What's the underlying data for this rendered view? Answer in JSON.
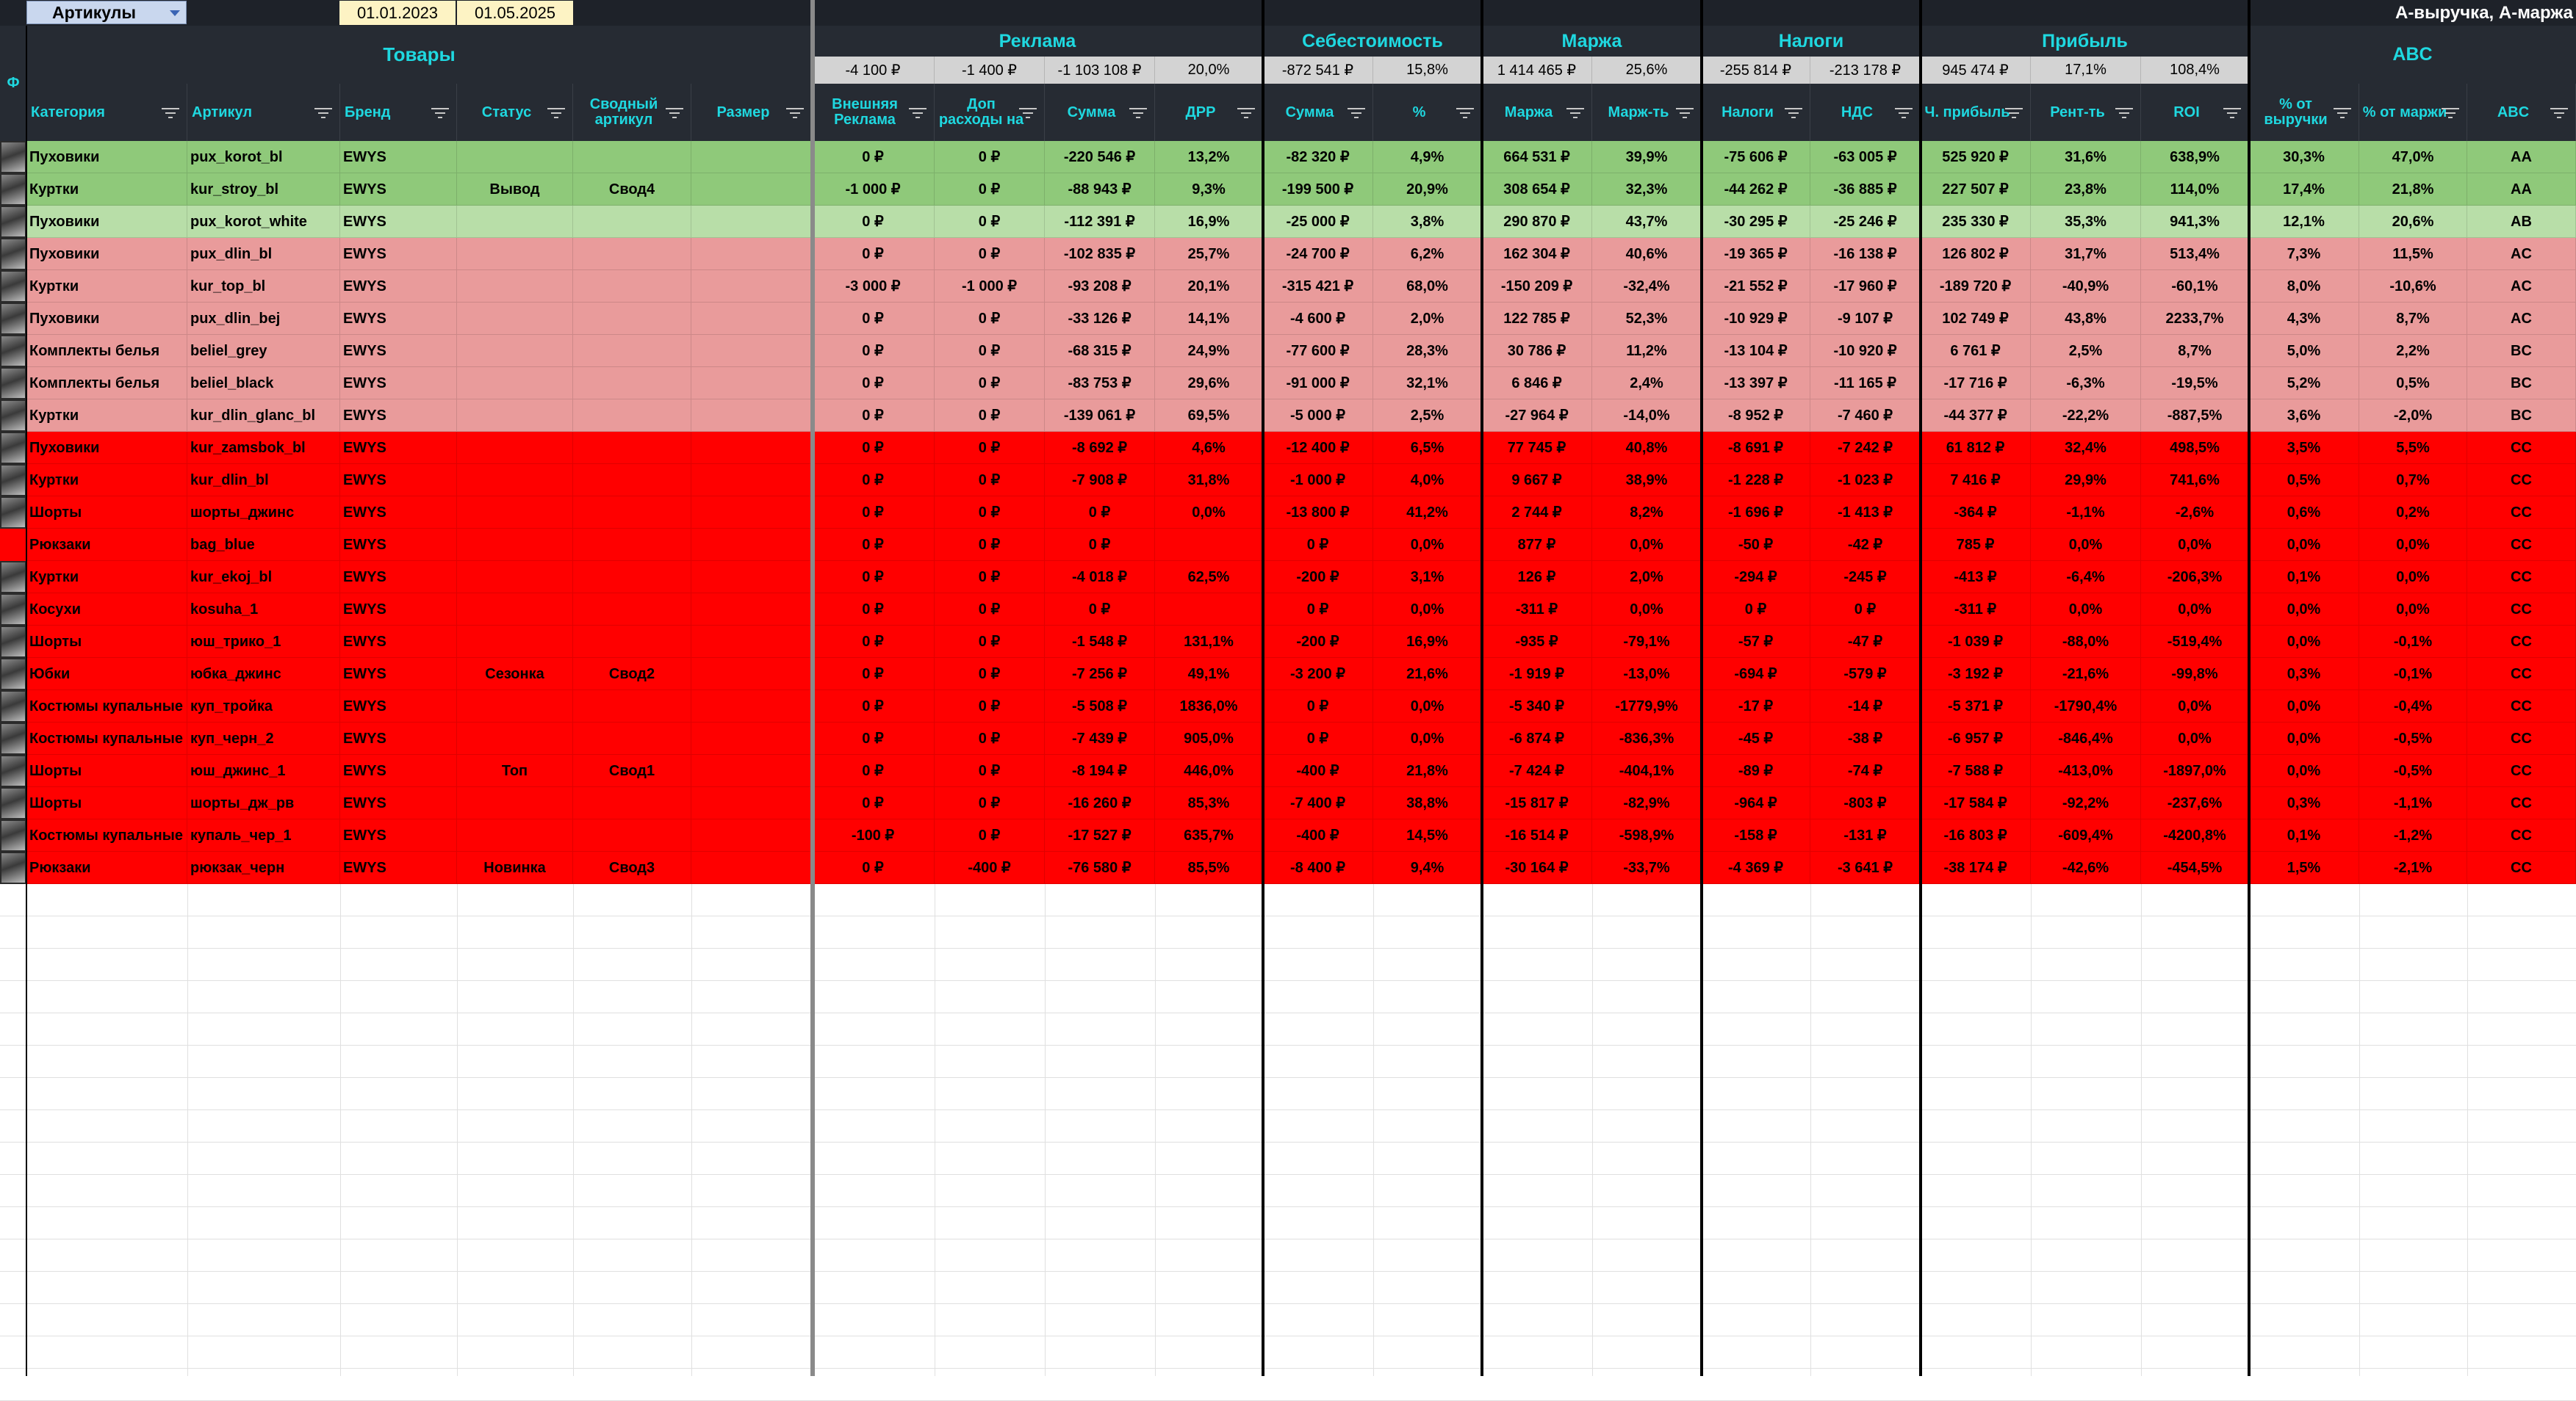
{
  "toolbar": {
    "selector_value": "Артикулы",
    "date_from": "01.01.2023",
    "date_to": "01.05.2025",
    "abc_mode": "А-выручка, А-маржа"
  },
  "colors": {
    "header_bg": "#262b33",
    "header_text": "#1fd8e0",
    "green_dark": "#8fc97a",
    "green_light": "#b8dea8",
    "pink": "#e99b9b",
    "red": "#ff0000"
  },
  "side_label": "Ф",
  "groups": {
    "goods": "Товары",
    "ads": "Реклама",
    "cost": "Себестоимость",
    "margin": "Маржа",
    "taxes": "Налоги",
    "profit": "Прибыль",
    "abc": "ABC"
  },
  "summary": [
    "-4 100 ₽",
    "-1 400 ₽",
    "-1 103 108 ₽",
    "20,0%",
    "-872 541 ₽",
    "15,8%",
    "1 414 465 ₽",
    "25,6%",
    "-255 814 ₽",
    "-213 178 ₽",
    "945 474 ₽",
    "17,1%",
    "108,4%"
  ],
  "columns": [
    "Категория",
    "Артикул",
    "Бренд",
    "Статус",
    "Сводный артикул",
    "Размер",
    "Внешняя Реклама",
    "Доп расходы на",
    "Сумма",
    "ДРР",
    "Сумма",
    "%",
    "Маржа",
    "Марж-ть",
    "Налоги",
    "НДС",
    "Ч. прибыль",
    "Рент-ть",
    "ROI",
    "% от выручки",
    "% от маржи",
    "ABC"
  ],
  "rows": [
    {
      "color": "green_dark",
      "photo": true,
      "cells": [
        "Пуховики",
        "pux_korot_bl",
        "EWYS",
        "",
        "",
        "",
        "0 ₽",
        "0 ₽",
        "-220 546 ₽",
        "13,2%",
        "-82 320 ₽",
        "4,9%",
        "664 531 ₽",
        "39,9%",
        "-75 606 ₽",
        "-63 005 ₽",
        "525 920 ₽",
        "31,6%",
        "638,9%",
        "30,3%",
        "47,0%",
        "AA"
      ]
    },
    {
      "color": "green_dark",
      "photo": true,
      "cells": [
        "Куртки",
        "kur_stroy_bl",
        "EWYS",
        "Вывод",
        "Свод4",
        "",
        "-1 000 ₽",
        "0 ₽",
        "-88 943 ₽",
        "9,3%",
        "-199 500 ₽",
        "20,9%",
        "308 654 ₽",
        "32,3%",
        "-44 262 ₽",
        "-36 885 ₽",
        "227 507 ₽",
        "23,8%",
        "114,0%",
        "17,4%",
        "21,8%",
        "AA"
      ]
    },
    {
      "color": "green_light",
      "photo": true,
      "cells": [
        "Пуховики",
        "pux_korot_white",
        "EWYS",
        "",
        "",
        "",
        "0 ₽",
        "0 ₽",
        "-112 391 ₽",
        "16,9%",
        "-25 000 ₽",
        "3,8%",
        "290 870 ₽",
        "43,7%",
        "-30 295 ₽",
        "-25 246 ₽",
        "235 330 ₽",
        "35,3%",
        "941,3%",
        "12,1%",
        "20,6%",
        "AB"
      ]
    },
    {
      "color": "pink",
      "photo": true,
      "cells": [
        "Пуховики",
        "pux_dlin_bl",
        "EWYS",
        "",
        "",
        "",
        "0 ₽",
        "0 ₽",
        "-102 835 ₽",
        "25,7%",
        "-24 700 ₽",
        "6,2%",
        "162 304 ₽",
        "40,6%",
        "-19 365 ₽",
        "-16 138 ₽",
        "126 802 ₽",
        "31,7%",
        "513,4%",
        "7,3%",
        "11,5%",
        "AC"
      ]
    },
    {
      "color": "pink",
      "photo": true,
      "cells": [
        "Куртки",
        "kur_top_bl",
        "EWYS",
        "",
        "",
        "",
        "-3 000 ₽",
        "-1 000 ₽",
        "-93 208 ₽",
        "20,1%",
        "-315 421 ₽",
        "68,0%",
        "-150 209 ₽",
        "-32,4%",
        "-21 552 ₽",
        "-17 960 ₽",
        "-189 720 ₽",
        "-40,9%",
        "-60,1%",
        "8,0%",
        "-10,6%",
        "AC"
      ]
    },
    {
      "color": "pink",
      "photo": true,
      "cells": [
        "Пуховики",
        "pux_dlin_bej",
        "EWYS",
        "",
        "",
        "",
        "0 ₽",
        "0 ₽",
        "-33 126 ₽",
        "14,1%",
        "-4 600 ₽",
        "2,0%",
        "122 785 ₽",
        "52,3%",
        "-10 929 ₽",
        "-9 107 ₽",
        "102 749 ₽",
        "43,8%",
        "2233,7%",
        "4,3%",
        "8,7%",
        "AC"
      ]
    },
    {
      "color": "pink",
      "photo": true,
      "cells": [
        "Комплекты белья",
        "beliel_grey",
        "EWYS",
        "",
        "",
        "",
        "0 ₽",
        "0 ₽",
        "-68 315 ₽",
        "24,9%",
        "-77 600 ₽",
        "28,3%",
        "30 786 ₽",
        "11,2%",
        "-13 104 ₽",
        "-10 920 ₽",
        "6 761 ₽",
        "2,5%",
        "8,7%",
        "5,0%",
        "2,2%",
        "BC"
      ]
    },
    {
      "color": "pink",
      "photo": true,
      "cells": [
        "Комплекты белья",
        "beliel_black",
        "EWYS",
        "",
        "",
        "",
        "0 ₽",
        "0 ₽",
        "-83 753 ₽",
        "29,6%",
        "-91 000 ₽",
        "32,1%",
        "6 846 ₽",
        "2,4%",
        "-13 397 ₽",
        "-11 165 ₽",
        "-17 716 ₽",
        "-6,3%",
        "-19,5%",
        "5,2%",
        "0,5%",
        "BC"
      ]
    },
    {
      "color": "pink",
      "photo": true,
      "cells": [
        "Куртки",
        "kur_dlin_glanc_bl",
        "EWYS",
        "",
        "",
        "",
        "0 ₽",
        "0 ₽",
        "-139 061 ₽",
        "69,5%",
        "-5 000 ₽",
        "2,5%",
        "-27 964 ₽",
        "-14,0%",
        "-8 952 ₽",
        "-7 460 ₽",
        "-44 377 ₽",
        "-22,2%",
        "-887,5%",
        "3,6%",
        "-2,0%",
        "BC"
      ]
    },
    {
      "color": "red",
      "photo": true,
      "cells": [
        "Пуховики",
        "kur_zamsbok_bl",
        "EWYS",
        "",
        "",
        "",
        "0 ₽",
        "0 ₽",
        "-8 692 ₽",
        "4,6%",
        "-12 400 ₽",
        "6,5%",
        "77 745 ₽",
        "40,8%",
        "-8 691 ₽",
        "-7 242 ₽",
        "61 812 ₽",
        "32,4%",
        "498,5%",
        "3,5%",
        "5,5%",
        "CC"
      ]
    },
    {
      "color": "red",
      "photo": true,
      "cells": [
        "Куртки",
        "kur_dlin_bl",
        "EWYS",
        "",
        "",
        "",
        "0 ₽",
        "0 ₽",
        "-7 908 ₽",
        "31,8%",
        "-1 000 ₽",
        "4,0%",
        "9 667 ₽",
        "38,9%",
        "-1 228 ₽",
        "-1 023 ₽",
        "7 416 ₽",
        "29,9%",
        "741,6%",
        "0,5%",
        "0,7%",
        "CC"
      ]
    },
    {
      "color": "red",
      "photo": true,
      "cells": [
        "Шорты",
        "шорты_джинс",
        "EWYS",
        "",
        "",
        "",
        "0 ₽",
        "0 ₽",
        "0 ₽",
        "0,0%",
        "-13 800 ₽",
        "41,2%",
        "2 744 ₽",
        "8,2%",
        "-1 696 ₽",
        "-1 413 ₽",
        "-364 ₽",
        "-1,1%",
        "-2,6%",
        "0,6%",
        "0,2%",
        "CC"
      ]
    },
    {
      "color": "red",
      "photo": false,
      "cells": [
        "Рюкзаки",
        "bag_blue",
        "EWYS",
        "",
        "",
        "",
        "0 ₽",
        "0 ₽",
        "0 ₽",
        "",
        "0 ₽",
        "0,0%",
        "877 ₽",
        "0,0%",
        "-50 ₽",
        "-42 ₽",
        "785 ₽",
        "0,0%",
        "0,0%",
        "0,0%",
        "0,0%",
        "CC"
      ]
    },
    {
      "color": "red",
      "photo": true,
      "cells": [
        "Куртки",
        "kur_ekoj_bl",
        "EWYS",
        "",
        "",
        "",
        "0 ₽",
        "0 ₽",
        "-4 018 ₽",
        "62,5%",
        "-200 ₽",
        "3,1%",
        "126 ₽",
        "2,0%",
        "-294 ₽",
        "-245 ₽",
        "-413 ₽",
        "-6,4%",
        "-206,3%",
        "0,1%",
        "0,0%",
        "CC"
      ]
    },
    {
      "color": "red",
      "photo": true,
      "cells": [
        "Косухи",
        "kosuha_1",
        "EWYS",
        "",
        "",
        "",
        "0 ₽",
        "0 ₽",
        "0 ₽",
        "",
        "0 ₽",
        "0,0%",
        "-311 ₽",
        "0,0%",
        "0 ₽",
        "0 ₽",
        "-311 ₽",
        "0,0%",
        "0,0%",
        "0,0%",
        "0,0%",
        "CC"
      ]
    },
    {
      "color": "red",
      "photo": true,
      "cells": [
        "Шорты",
        "юш_трико_1",
        "EWYS",
        "",
        "",
        "",
        "0 ₽",
        "0 ₽",
        "-1 548 ₽",
        "131,1%",
        "-200 ₽",
        "16,9%",
        "-935 ₽",
        "-79,1%",
        "-57 ₽",
        "-47 ₽",
        "-1 039 ₽",
        "-88,0%",
        "-519,4%",
        "0,0%",
        "-0,1%",
        "CC"
      ]
    },
    {
      "color": "red",
      "photo": true,
      "cells": [
        "Юбки",
        "юбка_джинс",
        "EWYS",
        "Сезонка",
        "Свод2",
        "",
        "0 ₽",
        "0 ₽",
        "-7 256 ₽",
        "49,1%",
        "-3 200 ₽",
        "21,6%",
        "-1 919 ₽",
        "-13,0%",
        "-694 ₽",
        "-579 ₽",
        "-3 192 ₽",
        "-21,6%",
        "-99,8%",
        "0,3%",
        "-0,1%",
        "CC"
      ]
    },
    {
      "color": "red",
      "photo": true,
      "cells": [
        "Костюмы купальные",
        "куп_тройка",
        "EWYS",
        "",
        "",
        "",
        "0 ₽",
        "0 ₽",
        "-5 508 ₽",
        "1836,0%",
        "0 ₽",
        "0,0%",
        "-5 340 ₽",
        "-1779,9%",
        "-17 ₽",
        "-14 ₽",
        "-5 371 ₽",
        "-1790,4%",
        "0,0%",
        "0,0%",
        "-0,4%",
        "CC"
      ]
    },
    {
      "color": "red",
      "photo": true,
      "cells": [
        "Костюмы купальные",
        "куп_черн_2",
        "EWYS",
        "",
        "",
        "",
        "0 ₽",
        "0 ₽",
        "-7 439 ₽",
        "905,0%",
        "0 ₽",
        "0,0%",
        "-6 874 ₽",
        "-836,3%",
        "-45 ₽",
        "-38 ₽",
        "-6 957 ₽",
        "-846,4%",
        "0,0%",
        "0,0%",
        "-0,5%",
        "CC"
      ]
    },
    {
      "color": "red",
      "photo": true,
      "cells": [
        "Шорты",
        "юш_джинс_1",
        "EWYS",
        "Топ",
        "Свод1",
        "",
        "0 ₽",
        "0 ₽",
        "-8 194 ₽",
        "446,0%",
        "-400 ₽",
        "21,8%",
        "-7 424 ₽",
        "-404,1%",
        "-89 ₽",
        "-74 ₽",
        "-7 588 ₽",
        "-413,0%",
        "-1897,0%",
        "0,0%",
        "-0,5%",
        "CC"
      ]
    },
    {
      "color": "red",
      "photo": true,
      "cells": [
        "Шорты",
        "шорты_дж_рв",
        "EWYS",
        "",
        "",
        "",
        "0 ₽",
        "0 ₽",
        "-16 260 ₽",
        "85,3%",
        "-7 400 ₽",
        "38,8%",
        "-15 817 ₽",
        "-82,9%",
        "-964 ₽",
        "-803 ₽",
        "-17 584 ₽",
        "-92,2%",
        "-237,6%",
        "0,3%",
        "-1,1%",
        "CC"
      ]
    },
    {
      "color": "red",
      "photo": true,
      "cells": [
        "Костюмы купальные",
        "купаль_чер_1",
        "EWYS",
        "",
        "",
        "",
        "-100 ₽",
        "0 ₽",
        "-17 527 ₽",
        "635,7%",
        "-400 ₽",
        "14,5%",
        "-16 514 ₽",
        "-598,9%",
        "-158 ₽",
        "-131 ₽",
        "-16 803 ₽",
        "-609,4%",
        "-4200,8%",
        "0,1%",
        "-1,2%",
        "CC"
      ]
    },
    {
      "color": "red",
      "photo": true,
      "cells": [
        "Рюкзаки",
        "рюкзак_черн",
        "EWYS",
        "Новинка",
        "Свод3",
        "",
        "0 ₽",
        "-400 ₽",
        "-76 580 ₽",
        "85,5%",
        "-8 400 ₽",
        "9,4%",
        "-30 164 ₽",
        "-33,7%",
        "-4 369 ₽",
        "-3 641 ₽",
        "-38 174 ₽",
        "-42,6%",
        "-454,5%",
        "1,5%",
        "-2,1%",
        "CC"
      ]
    }
  ]
}
